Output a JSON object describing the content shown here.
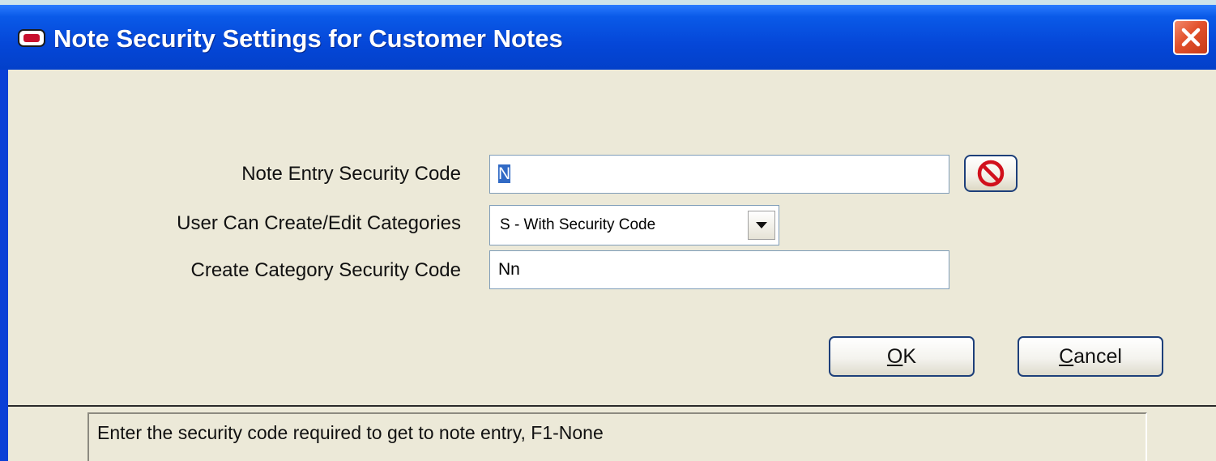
{
  "window": {
    "title": "Note Security Settings for Customer Notes",
    "title_icon": "app-window-icon",
    "close_icon": "close-icon"
  },
  "form": {
    "note_entry_label": "Note Entry Security Code",
    "note_entry_value": "N",
    "block_icon": "no-entry-icon",
    "categories_label": "User Can Create/Edit Categories",
    "categories_value": "S - With Security Code",
    "create_category_label": "Create Category Security Code",
    "create_category_value": "Nn"
  },
  "buttons": {
    "ok_mnemonic": "O",
    "ok_rest": "K",
    "cancel_mnemonic": "C",
    "cancel_rest": "ancel"
  },
  "status": {
    "text": "Enter the security code required to get to note entry, F1-None"
  },
  "colors": {
    "titlebar": "#0547d8",
    "client_bg": "#ece9d8",
    "close_button": "#e2502b",
    "selection": "#316ac5"
  }
}
